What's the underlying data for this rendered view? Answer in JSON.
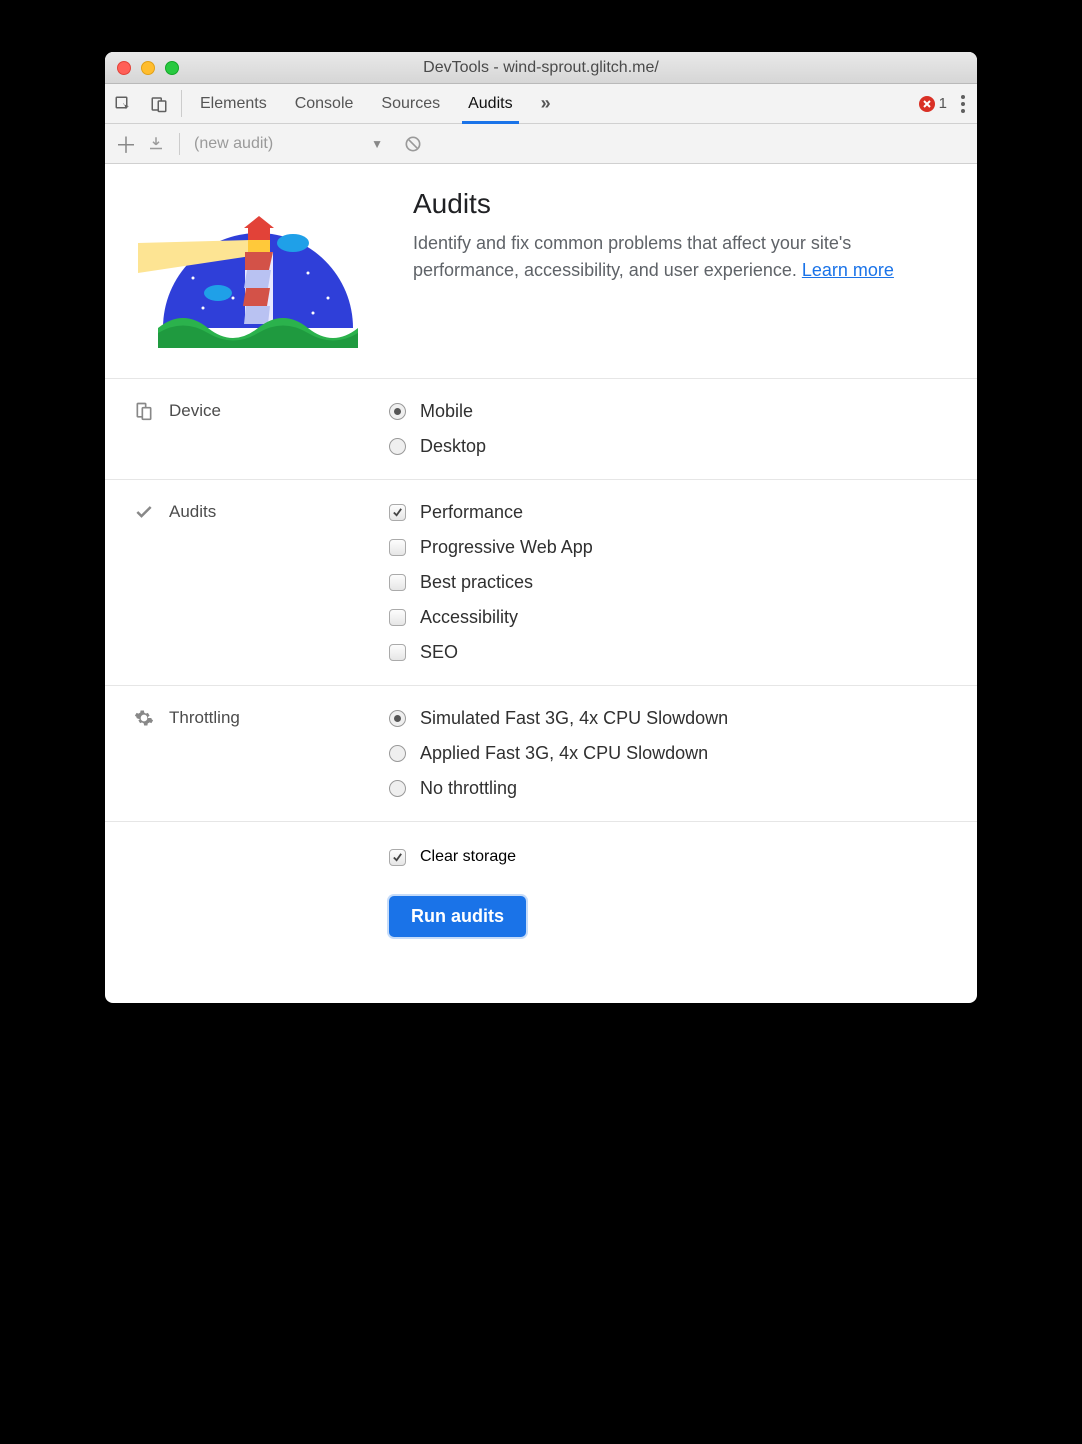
{
  "window": {
    "title": "DevTools - wind-sprout.glitch.me/"
  },
  "tabs": {
    "items": [
      "Elements",
      "Console",
      "Sources",
      "Audits"
    ],
    "active": "Audits",
    "error_count": "1"
  },
  "toolbar": {
    "audit_name": "(new audit)"
  },
  "hero": {
    "title": "Audits",
    "desc_prefix": "Identify and fix common problems that affect your site's performance, accessibility, and user experience. ",
    "learn_more": "Learn more"
  },
  "sections": {
    "device": {
      "label": "Device",
      "options": [
        {
          "label": "Mobile",
          "checked": true
        },
        {
          "label": "Desktop",
          "checked": false
        }
      ]
    },
    "audits": {
      "label": "Audits",
      "options": [
        {
          "label": "Performance",
          "checked": true
        },
        {
          "label": "Progressive Web App",
          "checked": false
        },
        {
          "label": "Best practices",
          "checked": false
        },
        {
          "label": "Accessibility",
          "checked": false
        },
        {
          "label": "SEO",
          "checked": false
        }
      ]
    },
    "throttling": {
      "label": "Throttling",
      "options": [
        {
          "label": "Simulated Fast 3G, 4x CPU Slowdown",
          "checked": true
        },
        {
          "label": "Applied Fast 3G, 4x CPU Slowdown",
          "checked": false
        },
        {
          "label": "No throttling",
          "checked": false
        }
      ]
    },
    "storage": {
      "label": "Clear storage",
      "checked": true
    }
  },
  "actions": {
    "run": "Run audits"
  }
}
